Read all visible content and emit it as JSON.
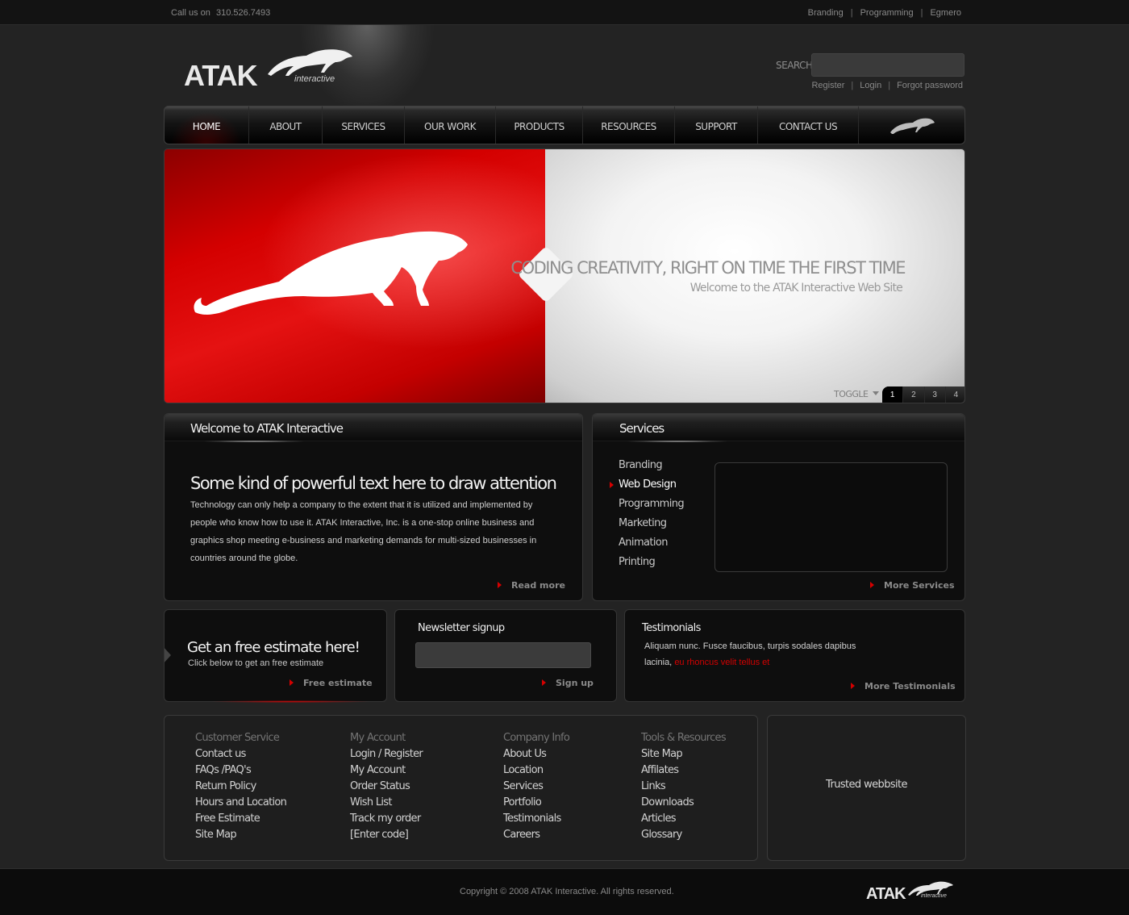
{
  "topbar": {
    "call_label": "Call us on",
    "phone": "310.526.7493",
    "links": [
      "Branding",
      "Programming",
      "Egmero"
    ],
    "separator": "|"
  },
  "logo": {
    "word": "ATAK",
    "sub": "interactive",
    "icon": "cougar-logo-icon"
  },
  "search": {
    "label": "SEARCH",
    "value": "",
    "placeholder": ""
  },
  "account_links": [
    "Register",
    "Login",
    "Forgot password"
  ],
  "nav": {
    "items": [
      "HOME",
      "ABOUT",
      "SERVICES",
      "OUR WORK",
      "PRODUCTS",
      "RESOURCES",
      "SUPPORT",
      "CONTACT US"
    ],
    "active": "HOME",
    "icon": "cougar-icon"
  },
  "hero": {
    "headline": "CODING CREATIVITY, RIGHT ON TIME THE FIRST TIME",
    "subline": "Welcome to the ATAK Interactive Web Site",
    "toggle_label": "TOGGLE",
    "pages": [
      "1",
      "2",
      "3",
      "4"
    ],
    "active_page": "1",
    "colors": {
      "red": "#d40000",
      "white": "#f4f4f4"
    }
  },
  "welcome": {
    "title": "Welcome to ATAK Interactive",
    "headline": "Some kind of powerful text here to draw attention",
    "body": "Technology can only help a company to the extent that it is utilized and implemented by people who know how to use it. ATAK Interactive, Inc. is a one-stop online business and graphics shop meeting e-business and marketing demands for multi-sized businesses in countries around the globe.",
    "more": "Read more"
  },
  "services": {
    "title": "Services",
    "items": [
      "Branding",
      "Web Design",
      "Programming",
      "Marketing",
      "Animation",
      "Printing"
    ],
    "active": "Web Design",
    "more": "More Services"
  },
  "estimate": {
    "title": "Get an free estimate here!",
    "sub": "Click below to get an free estimate",
    "more": "Free estimate"
  },
  "newsletter": {
    "title": "Newsletter signup",
    "value": "",
    "more": "Sign up"
  },
  "testimonials": {
    "title": "Testimonials",
    "text": "Aliquam nunc. Fusce faucibus, turpis sodales dapibus lacinia,",
    "highlight": "eu rhoncus velit tellus et",
    "more": "More Testimonials"
  },
  "footer": {
    "columns": [
      {
        "heading": "Customer Service",
        "links": [
          "Contact us",
          "FAQs /PAQ's",
          "Return Policy",
          "Hours and Location",
          "Free Estimate",
          "Site Map"
        ]
      },
      {
        "heading": "My Account",
        "links": [
          "Login / Register",
          "My Account",
          "Order Status",
          "Wish List",
          "Track my order",
          "[Enter code]"
        ]
      },
      {
        "heading": "Company Info",
        "links": [
          "About Us",
          "Location",
          "Services",
          "Portfolio",
          "Testimonials",
          "Careers"
        ]
      },
      {
        "heading": "Tools  & Resources",
        "links": [
          "Site Map",
          "Affilates",
          "Links",
          "Downloads",
          "Articles",
          "Glossary"
        ]
      }
    ],
    "trusted": "Trusted webbsite",
    "copyright": "Copyright © 2008 ATAK Interactive. All rights reserved."
  }
}
